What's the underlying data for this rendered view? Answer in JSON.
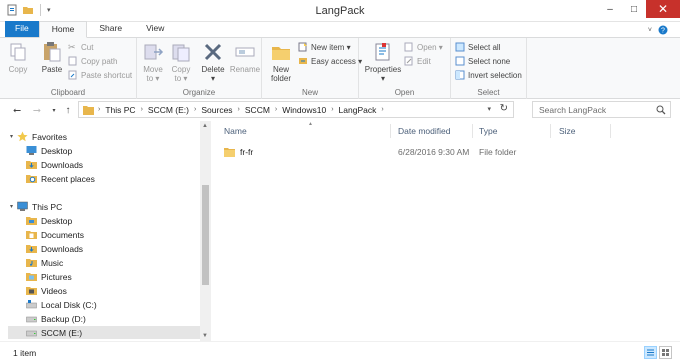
{
  "window": {
    "title": "LangPack",
    "minimize": "–",
    "maximize": "□",
    "close": "✕"
  },
  "ribbon_tabs": [
    "File",
    "Home",
    "Share",
    "View"
  ],
  "ribbon": {
    "clipboard": {
      "label": "Clipboard",
      "copy": "Copy",
      "paste": "Paste",
      "cut": "Cut",
      "copy_path": "Copy path",
      "paste_shortcut": "Paste shortcut"
    },
    "organize": {
      "label": "Organize",
      "move_to": "Move\nto ▾",
      "copy_to": "Copy\nto ▾",
      "delete": "Delete\n▾",
      "rename": "Rename"
    },
    "new": {
      "label": "New",
      "new_folder": "New\nfolder",
      "new_item": "New item ▾",
      "easy_access": "Easy access ▾"
    },
    "open": {
      "label": "Open",
      "properties": "Properties\n▾",
      "open": "Open ▾",
      "edit": "Edit"
    },
    "select": {
      "label": "Select",
      "select_all": "Select all",
      "select_none": "Select none",
      "invert": "Invert selection"
    }
  },
  "address": {
    "breadcrumbs": [
      "This PC",
      "SCCM (E:)",
      "Sources",
      "SCCM",
      "Windows10",
      "LangPack"
    ],
    "search_placeholder": "Search LangPack"
  },
  "nav": {
    "favorites": {
      "label": "Favorites",
      "items": [
        "Desktop",
        "Downloads",
        "Recent places"
      ]
    },
    "this_pc": {
      "label": "This PC",
      "items": [
        "Desktop",
        "Documents",
        "Downloads",
        "Music",
        "Pictures",
        "Videos",
        "Local Disk (C:)",
        "Backup (D:)",
        "SCCM (E:)"
      ]
    }
  },
  "columns": [
    "Name",
    "Date modified",
    "Type",
    "Size"
  ],
  "rows": [
    {
      "name": "fr-fr",
      "date": "6/28/2016 9:30 AM",
      "type": "File folder",
      "size": ""
    }
  ],
  "status": {
    "count": "1 item"
  },
  "icons": {
    "folder": "folder-icon",
    "star": "star-icon",
    "pc": "pc-icon",
    "drive": "drive-icon"
  },
  "colors": {
    "accent": "#1979ca",
    "close": "#c7312b",
    "folder": "#e8b64c",
    "header_text": "#4c607a"
  }
}
